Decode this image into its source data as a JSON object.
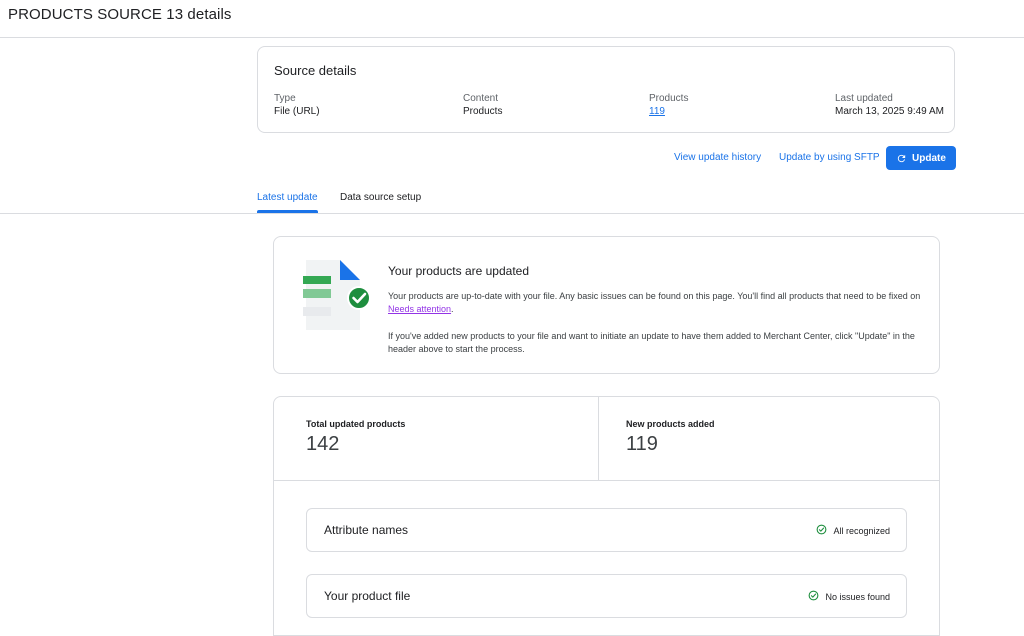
{
  "page": {
    "title": "PRODUCTS SOURCE 13 details"
  },
  "source_details": {
    "title": "Source details",
    "fields": [
      {
        "label": "Type",
        "value": "File (URL)"
      },
      {
        "label": "Content",
        "value": "Products"
      },
      {
        "label": "Products",
        "value": "119"
      },
      {
        "label": "Last updated",
        "value": "March 13, 2025 9:49 AM"
      }
    ]
  },
  "actions": {
    "view_history": "View update history",
    "update_sftp": "Update by using SFTP",
    "update": "Update"
  },
  "tabs": [
    {
      "label": "Latest update",
      "active": true
    },
    {
      "label": "Data source setup",
      "active": false
    }
  ],
  "status": {
    "title": "Your products are updated",
    "p1_text": "Your products are up-to-date with your file. Any basic issues can be found on this page. You'll find all products that need to be fixed on ",
    "p1_link": "Needs attention",
    "p1_end": ".",
    "p2": "If you've added new products to your file and want to initiate an update to have them added to Merchant Center, click \"Update\" in the header above to start the process."
  },
  "stats": [
    {
      "label": "Total updated products",
      "value": "142"
    },
    {
      "label": "New products added",
      "value": "119"
    }
  ],
  "checks": [
    {
      "label": "Attribute names",
      "status": "All recognized"
    },
    {
      "label": "Your product file",
      "status": "No issues found"
    }
  ],
  "colors": {
    "accent": "#1a73e8",
    "success": "#1e8e3e",
    "link_visited": "#9334e6"
  }
}
